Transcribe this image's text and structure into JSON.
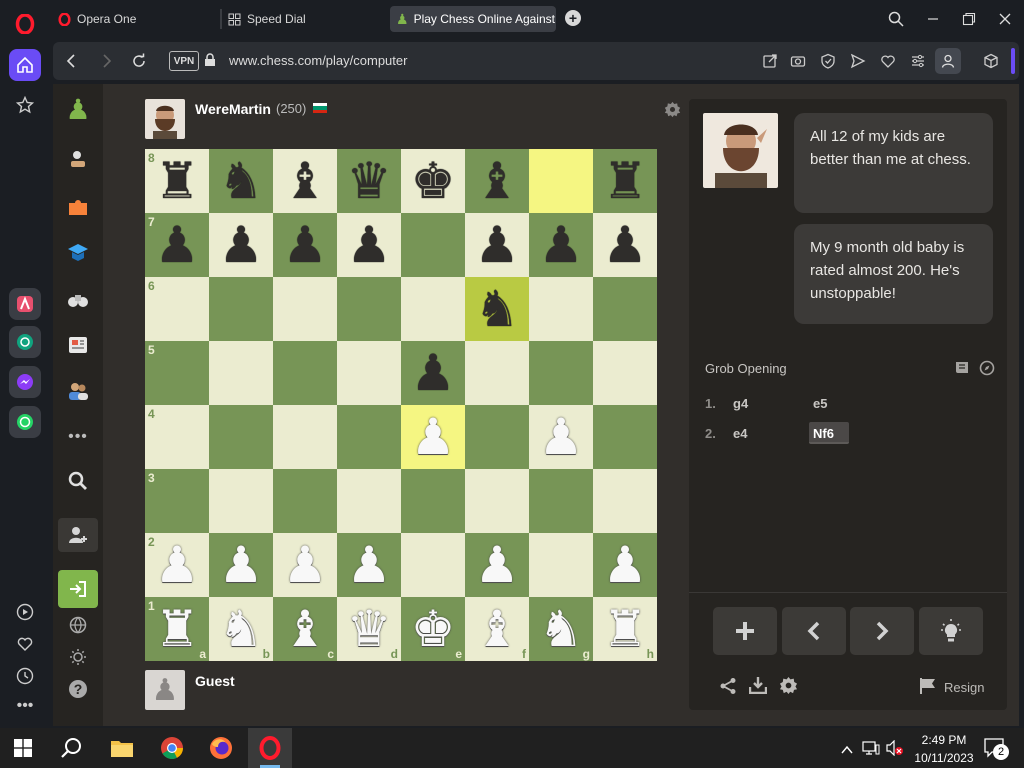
{
  "browser": {
    "tabs": [
      {
        "label": "Opera One"
      },
      {
        "label": "Speed Dial"
      },
      {
        "label": "Play Chess Online Against"
      }
    ],
    "new_tab": "+",
    "vpn": "VPN",
    "url": "www.chess.com/play/computer"
  },
  "opponent": {
    "name": "WereMartin",
    "rating": "(250)"
  },
  "player": {
    "name": "Guest"
  },
  "board": {
    "ranks": [
      "8",
      "7",
      "6",
      "5",
      "4",
      "3",
      "2",
      "1"
    ],
    "files": [
      "a",
      "b",
      "c",
      "d",
      "e",
      "f",
      "g",
      "h"
    ],
    "position": [
      [
        "♜",
        "♞",
        "♝",
        "♛",
        "♚",
        "♝",
        "",
        "♜"
      ],
      [
        "♟",
        "♟",
        "♟",
        "♟",
        "",
        "♟",
        "♟",
        "♟"
      ],
      [
        "",
        "",
        "",
        "",
        "",
        "♞",
        "",
        ""
      ],
      [
        "",
        "",
        "",
        "",
        "♟",
        "",
        "",
        ""
      ],
      [
        "",
        "",
        "",
        "",
        "♙",
        "",
        "♙",
        ""
      ],
      [
        "",
        "",
        "",
        "",
        "",
        "",
        "",
        ""
      ],
      [
        "♙",
        "♙",
        "♙",
        "♙",
        "",
        "♙",
        "",
        "♙"
      ],
      [
        "♖",
        "♘",
        "♗",
        "♕",
        "♔",
        "♗",
        "♘",
        "♖"
      ]
    ],
    "highlight": [
      "f6",
      "g8",
      "e4"
    ]
  },
  "chat": {
    "message1": "All 12 of my kids are better than me at chess.",
    "message2": "My 9 month old baby is rated almost 200. He's unstoppable!"
  },
  "opening": {
    "name": "Grob Opening"
  },
  "moves": [
    {
      "number": "1.",
      "white": "g4",
      "black": "e5"
    },
    {
      "number": "2.",
      "white": "e4",
      "black": "Nf6"
    }
  ],
  "controls": {
    "resign": "Resign"
  },
  "taskbar": {
    "time": "2:49 PM",
    "date": "10/11/2023",
    "notifications": "2"
  },
  "colors": {
    "accent": "#779556",
    "light_square": "#ebecd0",
    "highlight": "#f5f682"
  }
}
